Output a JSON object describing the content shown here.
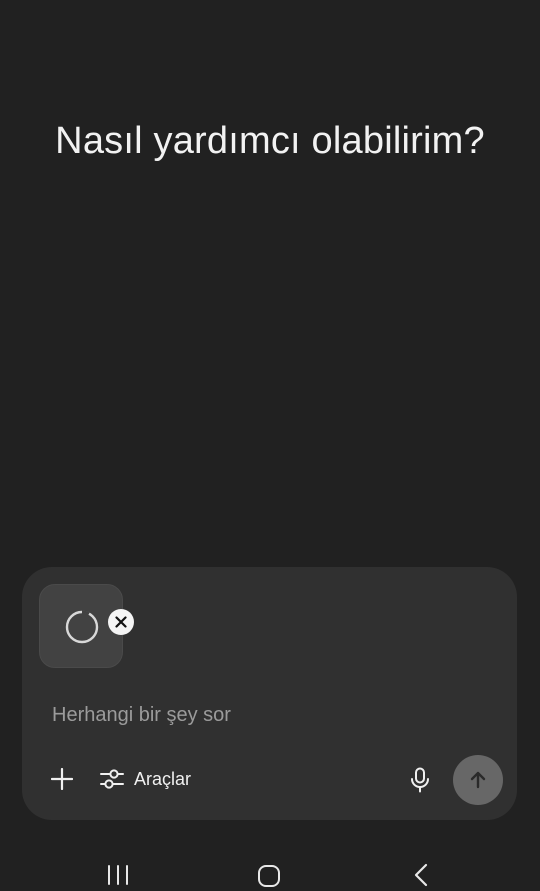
{
  "main": {
    "headline": "Nasıl yardımcı olabilirim?"
  },
  "composer": {
    "placeholder": "Herhangi bir şey sor",
    "value": "",
    "tools_label": "Araçlar",
    "attachment_state": "loading"
  },
  "icons": {
    "attachment": "loading-spinner-icon",
    "remove": "close-icon",
    "add": "plus-icon",
    "tools": "sliders-icon",
    "mic": "microphone-icon",
    "send": "arrow-up-icon",
    "nav_recents": "recents-icon",
    "nav_home": "home-icon",
    "nav_back": "back-icon"
  },
  "colors": {
    "background": "#212121",
    "composer_bg": "#303030",
    "send_button": "#676767",
    "text": "#f2f2f2",
    "placeholder": "#9b9b9b"
  }
}
